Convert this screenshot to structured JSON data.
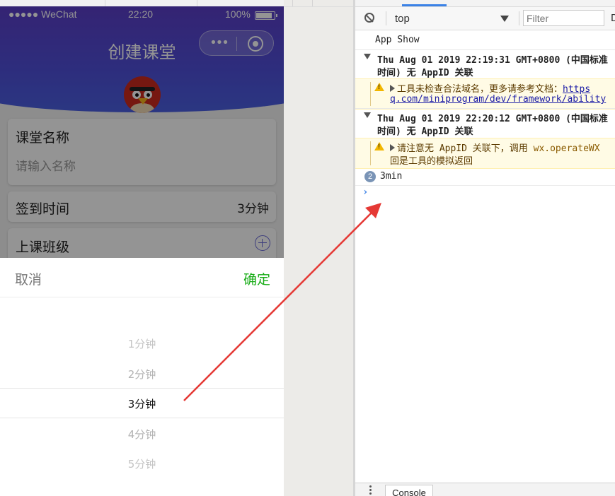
{
  "phone": {
    "status_bar": {
      "carrier": "●●●●● WeChat",
      "time": "22:20",
      "battery": "100%"
    },
    "nav_title": "创建课堂",
    "form": {
      "name_label": "课堂名称",
      "name_placeholder": "请输入名称",
      "time_label": "签到时间",
      "time_value": "3分钟",
      "class_label": "上课班级"
    },
    "picker": {
      "cancel": "取消",
      "confirm": "确定",
      "options": [
        "1分钟",
        "2分钟",
        "3分钟",
        "4分钟",
        "5分钟"
      ],
      "selected": "3分钟"
    }
  },
  "devtools": {
    "context": "top",
    "filter_placeholder": "Filter",
    "filter_more": "D",
    "drawer_tab": "Console",
    "logs": {
      "app_show": "App Show",
      "group1_line1": "Thu Aug 01 2019 22:19:31 GMT+0800 (中国标准",
      "group1_line2": "时间) 无 AppID 关联",
      "warn1_line1_text": "工具未检查合法域名，更多请参考文档：",
      "warn1_line1_link": "https",
      "warn1_line2": "q.com/miniprogram/dev/framework/ability",
      "group2_line1": "Thu Aug 01 2019 22:20:12 GMT+0800 (中国标准",
      "group2_line2": "时间) 无 AppID 关联",
      "warn2_line1_text": "请注意无 AppID 关联下，调用 ",
      "warn2_line1_code": "wx.operateWX",
      "warn2_line2": "回是工具的模拟返回",
      "count": "2",
      "count_text": "3min"
    }
  },
  "colors": {
    "header_purple": "#5b3ec7",
    "confirm_green": "#1aad19",
    "warning_bg": "#fffbe5",
    "annotation_red": "#e53935"
  }
}
